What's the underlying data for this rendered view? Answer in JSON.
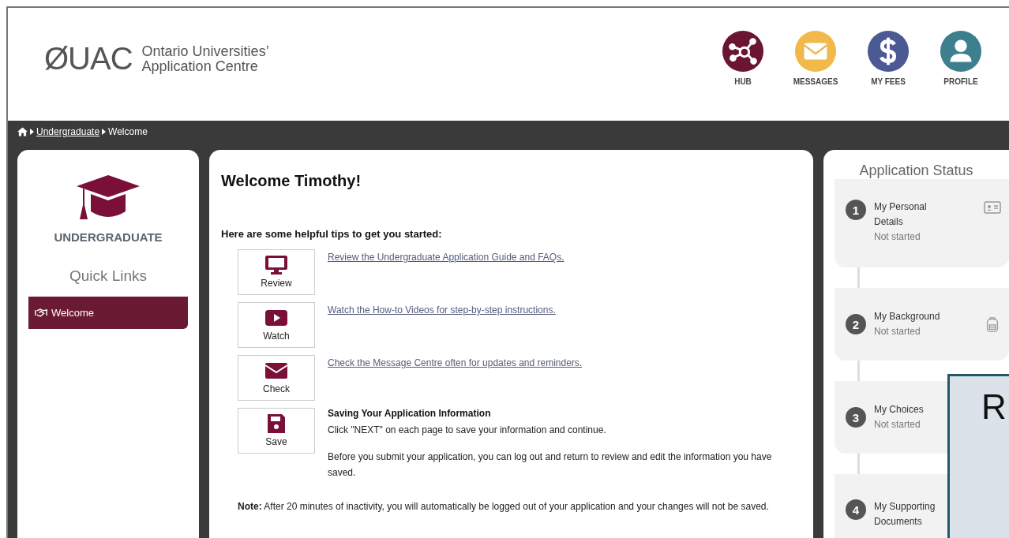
{
  "header": {
    "logo_mark": "ØUAC",
    "logo_text": [
      "Ontario Universities’",
      "Application Centre"
    ],
    "nav": [
      {
        "label": "HUB",
        "kind": "hub",
        "color": "#6b1533"
      },
      {
        "label": "MESSAGES",
        "kind": "mail",
        "color": "#f0b94a"
      },
      {
        "label": "MY FEES",
        "kind": "dollar",
        "color": "#4b5a92"
      },
      {
        "label": "PROFILE",
        "kind": "person",
        "color": "#3d7f8c"
      }
    ]
  },
  "breadcrumb": {
    "link": "Undergraduate",
    "current": "Welcome"
  },
  "sidebar": {
    "title": "UNDERGRADUATE",
    "quick_links_heading": "Quick Links",
    "items": [
      {
        "label": "Welcome",
        "selected": true
      }
    ]
  },
  "main": {
    "title": "Welcome Timothy!",
    "intro": "Here are some helpful tips to get you started:",
    "tips": [
      {
        "kind": "monitor",
        "button": "Review",
        "text": "Review the Undergraduate Application Guide and FAQs."
      },
      {
        "kind": "video",
        "button": "Watch",
        "text": "Watch the How-to Videos for step-by-step instructions."
      },
      {
        "kind": "mail",
        "button": "Check",
        "text": "Check the Message Centre often for updates and reminders."
      },
      {
        "kind": "save",
        "button": "Save",
        "heading": "Saving Your Application Information",
        "paragraphs": [
          "Click \"NEXT\" on each page to save your information and continue.",
          "Before you submit your application, you can log out and return to review and edit the information you have saved."
        ]
      }
    ],
    "note": "**Note:** After 20 minutes of inactivity, you will automatically be logged out of your application and your changes will not be saved."
  },
  "status": {
    "title": "Application Status",
    "steps": [
      {
        "number": "1",
        "title": "My Personal Details",
        "state": "Not started",
        "kind": "id-card"
      },
      {
        "number": "2",
        "title": "My Background",
        "state": "Not started",
        "kind": "backpack"
      },
      {
        "number": "3",
        "title": "My Choices",
        "state": "Not started",
        "kind": "none"
      },
      {
        "number": "4",
        "title": "My Supporting Documents",
        "kind": "none"
      }
    ]
  },
  "overlay": {
    "text": "R"
  }
}
